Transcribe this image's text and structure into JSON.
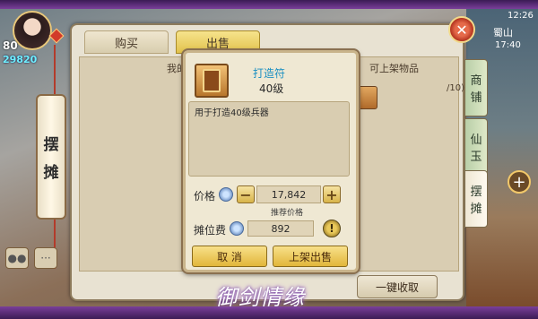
{
  "status": {
    "time": "12:26"
  },
  "location": {
    "name": "蜀山",
    "clock": "17:40"
  },
  "player": {
    "level": "80",
    "power": "29820"
  },
  "side_tab": {
    "chars": [
      "摆",
      "摊"
    ]
  },
  "panel": {
    "tabs": [
      {
        "label": "购买"
      },
      {
        "label": "出售"
      }
    ],
    "header_left": "我的",
    "header_right": "可上架物品",
    "capacity": "/10)",
    "collect_all": "一键收取"
  },
  "right_tabs": [
    {
      "chars": [
        "商",
        "铺"
      ]
    },
    {
      "chars": [
        "仙",
        "玉"
      ]
    },
    {
      "chars": [
        "摆",
        "摊"
      ]
    }
  ],
  "dialog": {
    "item_name": "打造符",
    "item_level": "40级",
    "description": "用于打造40级兵器",
    "price_label": "价格",
    "price_value": "17,842",
    "minus": "−",
    "plus": "+",
    "suggest_label": "推荐价格",
    "fee_label": "摊位费",
    "fee_value": "892",
    "info": "!",
    "cancel_label": "取 消",
    "confirm_label": "上架出售"
  },
  "logo_text": "御剑情缘",
  "colors": {
    "frame": "#3b1b55",
    "accent_gold": "#e2c24c",
    "item_name": "#1a8fc2"
  }
}
